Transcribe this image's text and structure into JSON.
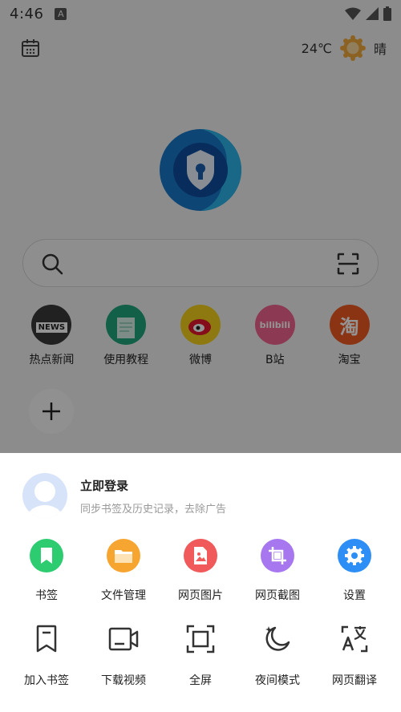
{
  "status_bar": {
    "time": "4:46",
    "notif_letter": "A"
  },
  "weather": {
    "temperature": "24℃",
    "condition": "晴"
  },
  "search": {
    "placeholder": ""
  },
  "shortcuts": [
    {
      "label": "热点新闻",
      "badge": "NEWS",
      "color": "#3a3a3a"
    },
    {
      "label": "使用教程",
      "color": "#1fa57d"
    },
    {
      "label": "微博",
      "color": "#f3d11c"
    },
    {
      "label": "B站",
      "badge": "bilibili",
      "color": "#f1638f"
    },
    {
      "label": "淘宝",
      "badge": "淘",
      "color": "#f05a22"
    }
  ],
  "login": {
    "title": "立即登录",
    "subtitle": "同步书签及历史记录，去除广告"
  },
  "menu_row1": [
    {
      "label": "书签",
      "icon": "bookmark-icon",
      "color": "#2ecc71"
    },
    {
      "label": "文件管理",
      "icon": "folder-icon",
      "color": "#f7a531"
    },
    {
      "label": "网页图片",
      "icon": "image-icon",
      "color": "#f05a5a"
    },
    {
      "label": "网页截图",
      "icon": "crop-icon",
      "color": "#a777f0"
    },
    {
      "label": "设置",
      "icon": "gear-icon",
      "color": "#2d8ef5"
    }
  ],
  "menu_row2": [
    {
      "label": "加入书签",
      "icon": "add-bookmark-icon"
    },
    {
      "label": "下载视频",
      "icon": "video-icon"
    },
    {
      "label": "全屏",
      "icon": "fullscreen-icon"
    },
    {
      "label": "夜间模式",
      "icon": "moon-icon"
    },
    {
      "label": "网页翻译",
      "icon": "translate-icon"
    }
  ]
}
